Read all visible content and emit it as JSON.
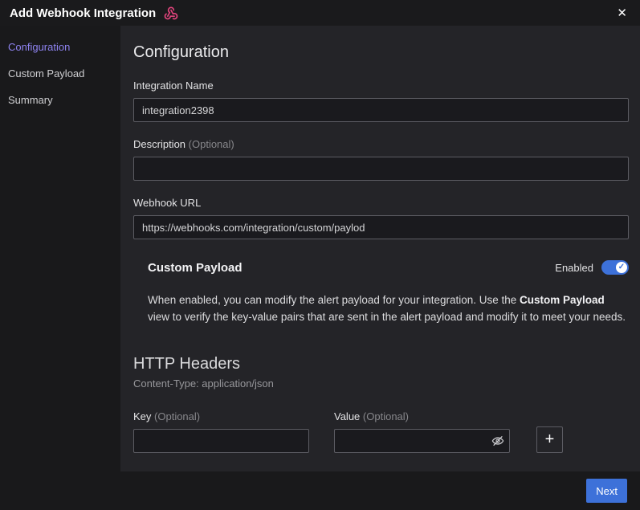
{
  "colors": {
    "accent_blue": "#3d71d9",
    "active_tab_purple": "#8e83f0",
    "webhook_icon_pink": "#e0447c",
    "toggle_on_blue": "#3d71d9"
  },
  "header": {
    "title": "Add Webhook Integration",
    "close_glyph": "✕"
  },
  "sidebar": {
    "items": [
      {
        "label": "Configuration",
        "active": true
      },
      {
        "label": "Custom Payload",
        "active": false
      },
      {
        "label": "Summary",
        "active": false
      }
    ]
  },
  "main": {
    "section_title": "Configuration",
    "fields": {
      "integration_name": {
        "label": "Integration Name",
        "value": "integration2398"
      },
      "description": {
        "label": "Description",
        "optional": "(Optional)",
        "value": ""
      },
      "webhook_url": {
        "label": "Webhook URL",
        "value": "https://webhooks.com/integration/custom/paylod"
      }
    },
    "custom_payload": {
      "title": "Custom Payload",
      "status": "Enabled",
      "toggle_check_glyph": "✓",
      "description": {
        "before": "When enabled, you can modify the alert payload for your integration. Use the ",
        "bold": "Custom Payload",
        "after": " view to verify the key-value pairs that are sent in the alert payload and modify it to meet your needs."
      }
    },
    "http_headers": {
      "title": "HTTP Headers",
      "subtitle": "Content-Type: application/json",
      "key_field": {
        "label": "Key",
        "optional": "(Optional)",
        "value": ""
      },
      "value_field": {
        "label": "Value",
        "optional": "(Optional)",
        "value": ""
      },
      "add_label": "+"
    }
  },
  "footer": {
    "next_label": "Next"
  }
}
